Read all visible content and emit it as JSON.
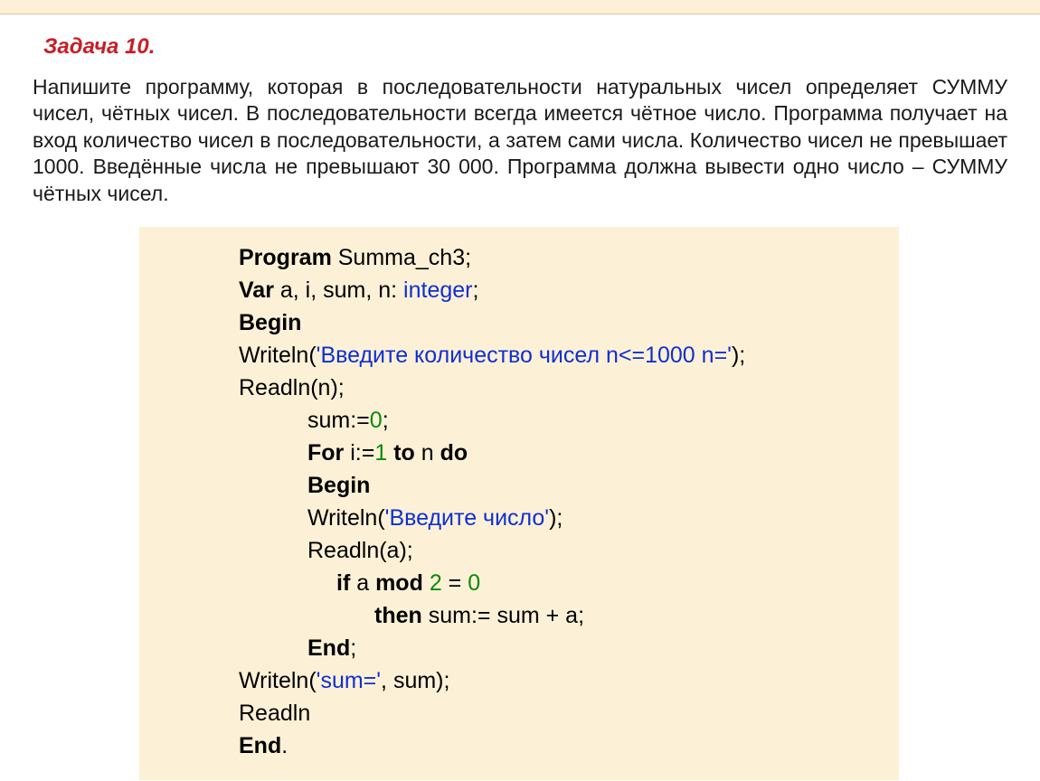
{
  "task": {
    "title": "Задача 10.",
    "text": "Напишите программу, которая в последовательности натуральных чисел определяет СУММУ чисел, чётных чисел. В последовательности всегда имеется чётное число. Программа получает на вход количество чисел в последовательности, а затем сами числа. Количество чисел не превышает 1000. Введённые числа не превышают 30 000. Программа должна вывести одно число – СУММУ чётных чисел."
  },
  "code": {
    "l1_kw": "Program",
    "l1_rest": " Summa_ch3;",
    "l2_kw": "Var",
    "l2_vars": " a, i, sum, n: ",
    "l2_type": "integer",
    "l2_end": ";",
    "l3_kw": "Begin",
    "l4_pre": "Writeln(",
    "l4_str": "'Введите количество чисел n<=1000 n='",
    "l4_post": ");",
    "l5": "Readln(n);",
    "l6_pre": "sum:=",
    "l6_num": "0",
    "l6_post": ";",
    "l7_kw1": "For",
    "l7_mid1": " i:=",
    "l7_num": "1",
    "l7_mid2": " ",
    "l7_kw2": "to",
    "l7_mid3": " n ",
    "l7_kw3": "do",
    "l8_kw": "Begin",
    "l9_pre": "Writeln(",
    "l9_str": "'Введите число'",
    "l9_post": ");",
    "l10": "Readln(a);",
    "l11_kw1": "if",
    "l11_mid1": " a ",
    "l11_kw2": "mod",
    "l11_mid2": " ",
    "l11_num": "2",
    "l11_mid3": " = ",
    "l11_num2": "0",
    "l12_kw": "then",
    "l12_rest": " sum:= sum + a;",
    "l13_kw": "End",
    "l13_post": ";",
    "l14_pre": "Writeln(",
    "l14_str": "'sum='",
    "l14_mid": ", sum",
    "l14_post": ");",
    "l15": "Readln",
    "l16_kw": "End",
    "l16_post": "."
  }
}
